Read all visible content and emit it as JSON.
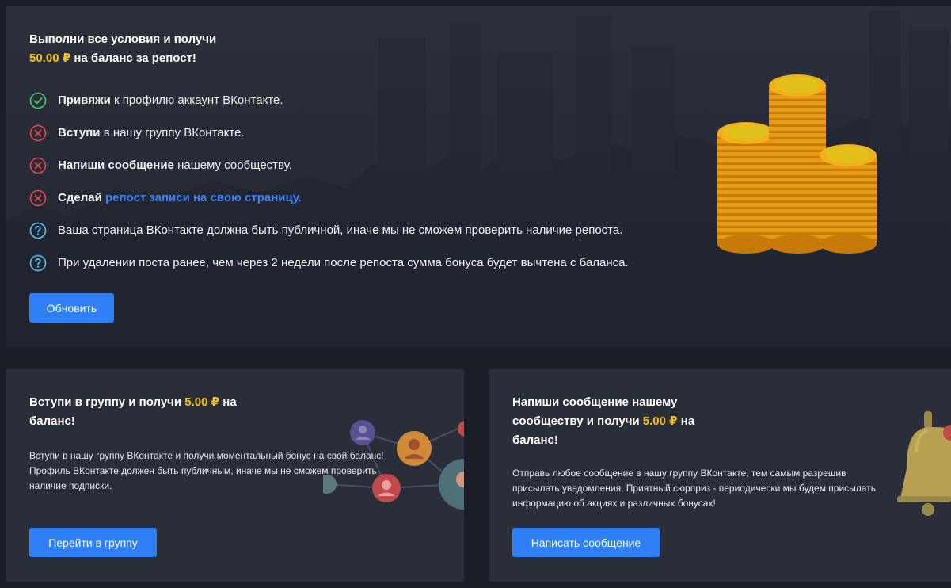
{
  "bonus_repost": {
    "title_line1": "Выполни все условия и получи",
    "amount": "50.00 ₽",
    "title_line2_suffix": " на баланс за репост!",
    "conditions": [
      {
        "status": "done",
        "icon": "check-circle-icon",
        "bold": "Привяжи",
        "rest": " к профилю аккаунт ВКонтакте."
      },
      {
        "status": "failed",
        "icon": "cross-circle-icon",
        "bold": "Вступи",
        "rest": " в нашу группу ВКонтакте."
      },
      {
        "status": "failed",
        "icon": "cross-circle-icon",
        "bold": "Напиши сообщение",
        "rest": " нашему сообществу."
      },
      {
        "status": "failed",
        "icon": "cross-circle-icon",
        "bold": "Сделай",
        "rest": " ",
        "link": "репост записи на свою страницу."
      },
      {
        "status": "info",
        "icon": "question-circle-icon",
        "text": "Ваша страница ВКонтакте должна быть публичной, иначе мы не сможем проверить наличие репоста."
      },
      {
        "status": "info",
        "icon": "question-circle-icon",
        "text": "При удалении поста ранее, чем через 2 недели после репоста сумма бонуса будет вычтена с баланса."
      }
    ],
    "refresh_label": "Обновить"
  },
  "group_card": {
    "title_prefix": "Вступи в группу и получи ",
    "amount": "5.00 ₽",
    "title_suffix": " на",
    "title_line2": "баланс!",
    "desc_line1": "Вступи в нашу группу ВКонтакте и получи моментальный бонус на свой баланс!",
    "desc_line2": "Профиль ВКонтакте должен быть публичным, иначе мы не сможем проверить",
    "desc_line3": "наличие подписки.",
    "button_label": "Перейти в группу"
  },
  "message_card": {
    "title_line1": "Напиши сообщение нашему",
    "title_line2_prefix": "сообществу и получи ",
    "amount": "5.00 ₽",
    "title_line2_suffix": " на",
    "title_line3": "баланс!",
    "desc_line1": "Отправь любое сообщение в нашу группу ВКонтакте, тем самым разрешив",
    "desc_line2": "присылать уведомления. Приятный сюрприз - периодически мы будем присылать",
    "desc_line3": "информацию об акциях и различных бонусах!",
    "button_label": "Написать сообщение"
  },
  "colors": {
    "accent_blue": "#2f7ff5",
    "gold": "#f5c30b",
    "success": "#3ecf6e",
    "error": "#e5484d",
    "info": "#4fc3f7"
  }
}
